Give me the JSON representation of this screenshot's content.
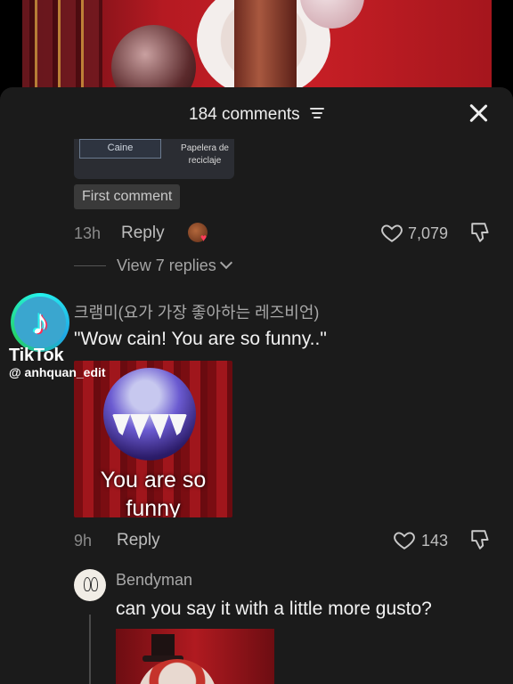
{
  "header": {
    "comments_count": "184 comments"
  },
  "previous_comment": {
    "image_labels": [
      "Caine",
      "Papelera de reciclaje"
    ],
    "badge": "First comment",
    "time": "13h",
    "reply_label": "Reply",
    "likes": "7,079",
    "view_replies": "View 7 replies"
  },
  "comment": {
    "username": "크램미(요가 가장 좋아하는 레즈비언)",
    "text": "\"Wow cain! You are so funny..\"",
    "gif_caption": "You are so funny",
    "time": "9h",
    "reply_label": "Reply",
    "likes": "143"
  },
  "reply": {
    "username": "Bendyman",
    "text": "can you say it with a little more gusto?"
  },
  "watermark": {
    "brand": "TikTok",
    "handle": "@ anhquan_edit"
  },
  "colors": {
    "sheet_bg": "#1b1b1b",
    "accent_red": "#c81f26",
    "tiktok_cyan": "#25f4ee",
    "tiktok_pink": "#fe2c55"
  }
}
